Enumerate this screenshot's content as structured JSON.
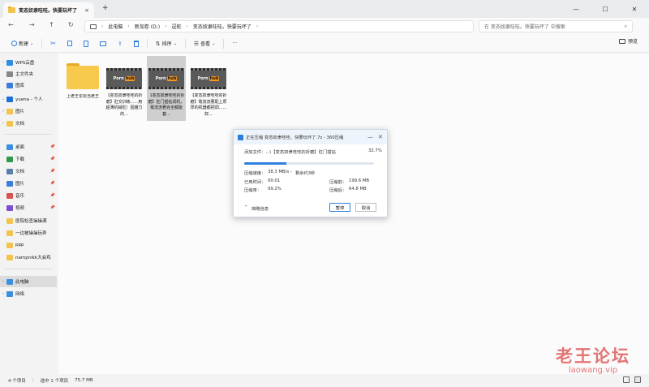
{
  "window": {
    "tab_title": "变态奴隶哇哇。快要玩坏了",
    "tab_close": "×",
    "new_tab": "+",
    "min": "—",
    "max": "☐",
    "close": "✕"
  },
  "nav": {
    "back": "←",
    "forward": "→",
    "up": "↑",
    "refresh": "↻",
    "breadcrumbs": [
      "此电脑",
      "新加卷 (D:)",
      "逗蛇",
      "变态奴隶哇哇。快要玩坏了"
    ],
    "sep": "›",
    "search_placeholder": "在 变态奴隶哇哇。快要玩坏了 中搜索",
    "search_icon": "⌕"
  },
  "toolbar": {
    "new_label": "新建",
    "sort_label": "排序",
    "view_label": "查看",
    "more": "···",
    "preview_label": "预览"
  },
  "sidebar": {
    "items": [
      {
        "label": "WPS云盘",
        "color": "#2f8de4",
        "chev": "›",
        "pin": ""
      },
      {
        "label": "主文件夹",
        "color": "#888888",
        "chev": "",
        "pin": ""
      },
      {
        "label": "图库",
        "color": "#3b7dd8",
        "chev": "",
        "pin": ""
      },
      {
        "label": "yuena - 个人",
        "color": "#1e6fd6",
        "chev": "⌄",
        "pin": ""
      },
      {
        "label": "图片",
        "color": "#f2c44d",
        "chev": "›",
        "pin": ""
      },
      {
        "label": "文档",
        "color": "#f2c44d",
        "chev": "›",
        "pin": ""
      },
      {
        "label": "桌面",
        "color": "#3b8fe0",
        "chev": "",
        "pin": "📌"
      },
      {
        "label": "下载",
        "color": "#2f9a4b",
        "chev": "",
        "pin": "📌"
      },
      {
        "label": "文档",
        "color": "#5b7fa8",
        "chev": "",
        "pin": "📌"
      },
      {
        "label": "图片",
        "color": "#3b7dd8",
        "chev": "",
        "pin": "📌"
      },
      {
        "label": "音乐",
        "color": "#d9534f",
        "chev": "",
        "pin": "📌"
      },
      {
        "label": "视频",
        "color": "#7b4fd0",
        "chev": "",
        "pin": "📌"
      },
      {
        "label": "医院检查操操满",
        "color": "#f2c44d",
        "chev": "",
        "pin": ""
      },
      {
        "label": "一边被操操玩弄",
        "color": "#f2c44d",
        "chev": "",
        "pin": ""
      },
      {
        "label": "ppp",
        "color": "#f2c44d",
        "chev": "",
        "pin": ""
      },
      {
        "label": "nampnikk大会鸡",
        "color": "#f2c44d",
        "chev": "",
        "pin": ""
      },
      {
        "label": "此电脑",
        "color": "#3b8fe0",
        "chev": "›",
        "pin": ""
      },
      {
        "label": "网络",
        "color": "#3b8fe0",
        "chev": "›",
        "pin": ""
      }
    ]
  },
  "files": [
    {
      "name": "上老王论坛当老王",
      "kind": "folder"
    },
    {
      "name": "【变态奴隶哇哇的折磨】肛交训练......用超薄机械肛）因猫力的...",
      "kind": "video",
      "logo": "Porn",
      "hub": "hub"
    },
    {
      "name": "【变态奴隶哇哇的折磨】肛门插钻调机，電流流著完全都能套...",
      "kind": "video",
      "logo": "Porn",
      "hub": "hub"
    },
    {
      "name": "【变态奴隶哇哇的折磨】電流流著配上厚厚的机器都把调......奴...",
      "kind": "video",
      "logo": "Porn",
      "hub": "hub"
    }
  ],
  "dialog": {
    "title": "正在压缩 变态奴隶哇哇。快要玩坏了.7z - 360压缩",
    "min": "—",
    "close": "✕",
    "current_file_label": "添加文件：...\\【变态奴隶哇哇的折磨】肛门插钻",
    "percent": "32.7%",
    "progress": 0.327,
    "speed_label": "压缩速度：",
    "speed": "38.3 MB/s",
    "remaining": "剩余约3秒",
    "elapsed_label": "已用时间：",
    "elapsed": "00:01",
    "rate_label": "压缩率：",
    "rate": "99.2%",
    "before_label": "压缩前：",
    "before": "199.6 MB",
    "after_label": "压缩后：",
    "after": "64.8 MB",
    "simple_label": "简略信息",
    "pause_label": "暂停",
    "cancel_label": "取消"
  },
  "status": {
    "count": "4 个项目",
    "selected": "选中 1 个项目",
    "size": "75.7 MB"
  },
  "watermark": {
    "cn": "老王论坛",
    "en": "laowang.vip"
  }
}
